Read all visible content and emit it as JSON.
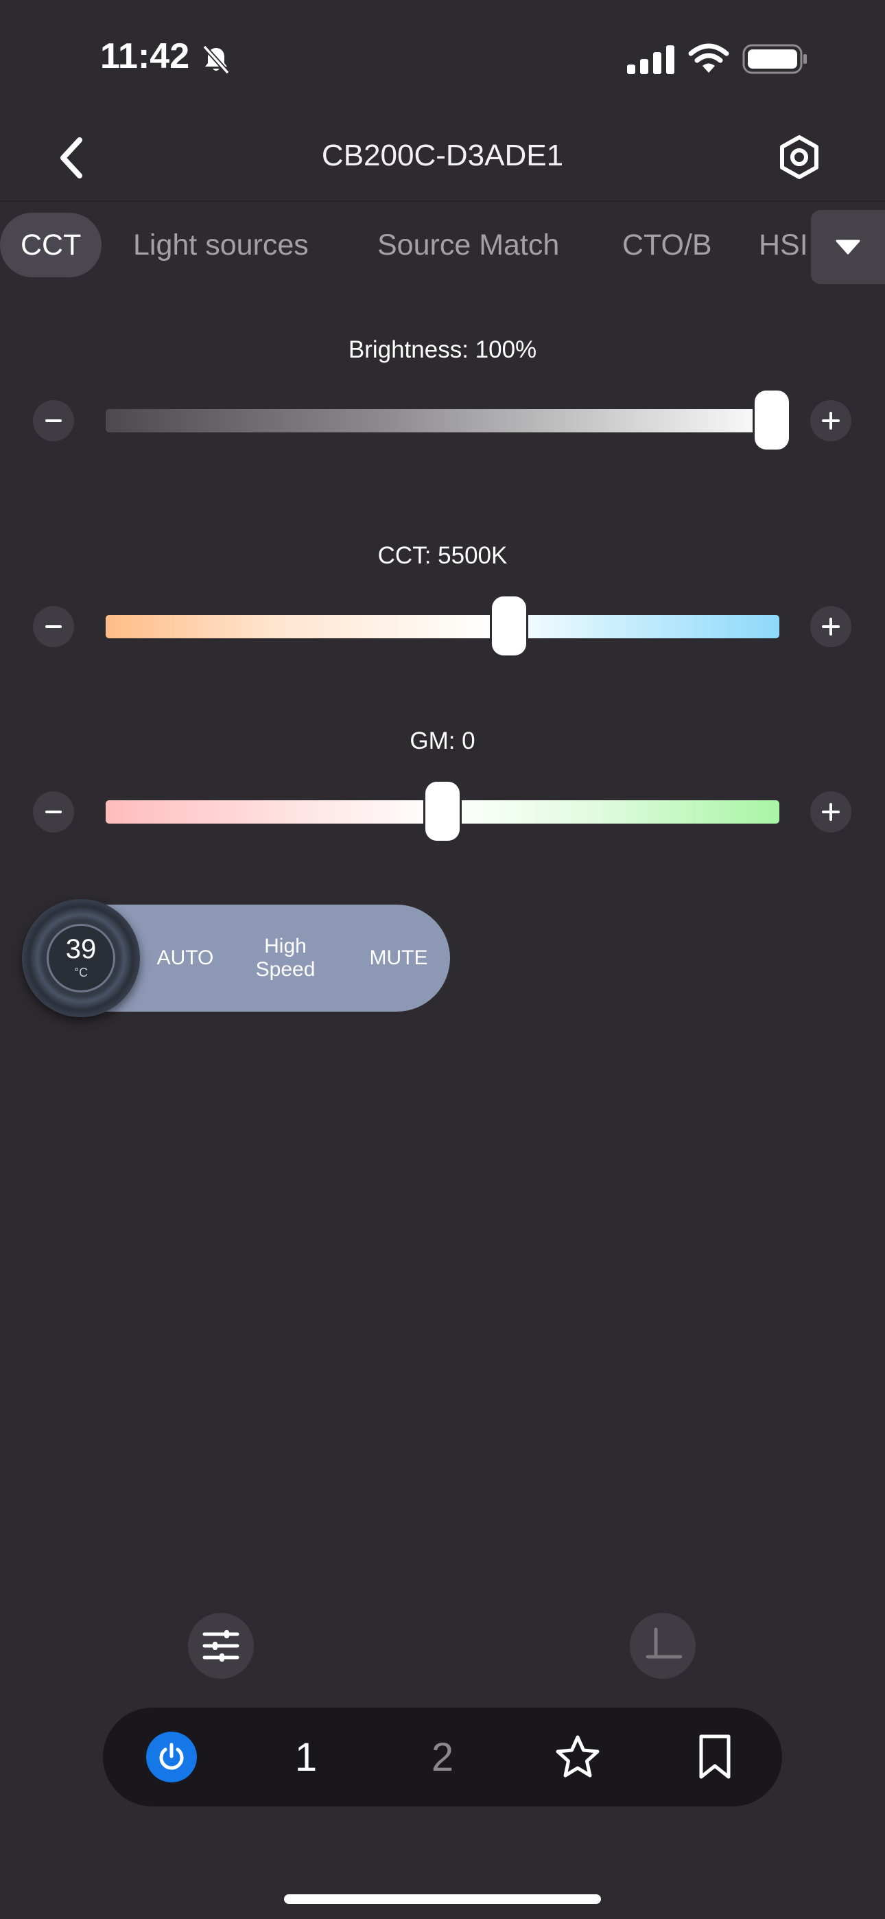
{
  "status_bar": {
    "time": "11:42",
    "icons": [
      "bell-slash-icon",
      "signal-icon",
      "wifi-icon",
      "battery-icon"
    ]
  },
  "header": {
    "title": "CB200C-D3ADE1",
    "back_icon": "chevron-left-icon",
    "settings_icon": "hexagon-gear-icon"
  },
  "tabs": [
    {
      "label": "CCT",
      "active": true
    },
    {
      "label": "Light sources",
      "active": false
    },
    {
      "label": "Source Match",
      "active": false
    },
    {
      "label": "CTO/B",
      "active": false
    },
    {
      "label": "HSI",
      "active": false
    }
  ],
  "sliders": {
    "brightness": {
      "label": "Brightness:  100%",
      "value_percent": 100
    },
    "cct": {
      "label": "CCT:  5500K",
      "value_fraction": 0.59
    },
    "gm": {
      "label": "GM:  0",
      "value_fraction": 0.5
    }
  },
  "fan": {
    "temperature": "39",
    "unit": "°C",
    "modes": {
      "auto": "AUTO",
      "high_speed": "High Speed",
      "mute": "MUTE"
    }
  },
  "bottom_nav": {
    "power_icon": "power-icon",
    "preset_1": "1",
    "preset_2": "2",
    "favorite_icon": "star-icon",
    "bookmark_icon": "bookmark-icon"
  },
  "colors": {
    "background": "#2e2b30",
    "accent": "#1677e8",
    "fan_pill": "#8d98b5"
  }
}
